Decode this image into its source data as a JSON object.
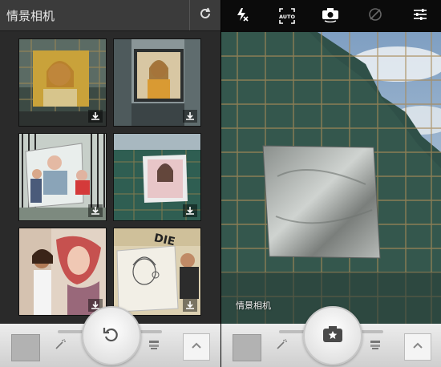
{
  "left": {
    "title": "情景相机",
    "refresh_icon": "refresh-icon"
  },
  "gallery": {
    "items": [
      {
        "name": "scaffold-billboard-girl"
      },
      {
        "name": "building-billboard-girl"
      },
      {
        "name": "fence-photo-couple"
      },
      {
        "name": "green-building-photo"
      },
      {
        "name": "woman-graffiti-wall"
      },
      {
        "name": "sketch-poster-man"
      }
    ],
    "download_icon": "download-icon"
  },
  "right": {
    "toolbar": {
      "flash": "flash-off-icon",
      "auto": "AUTO",
      "switch_camera": "camera-switch-icon",
      "rotate_disabled": "rotate-disabled-icon",
      "settings": "sliders-icon"
    },
    "watermark": "情景相机"
  },
  "bottom": {
    "left_action_icon": "undo-icon",
    "right_action_icon": "star-camera-icon",
    "up_icon": "chevron-up-icon"
  }
}
